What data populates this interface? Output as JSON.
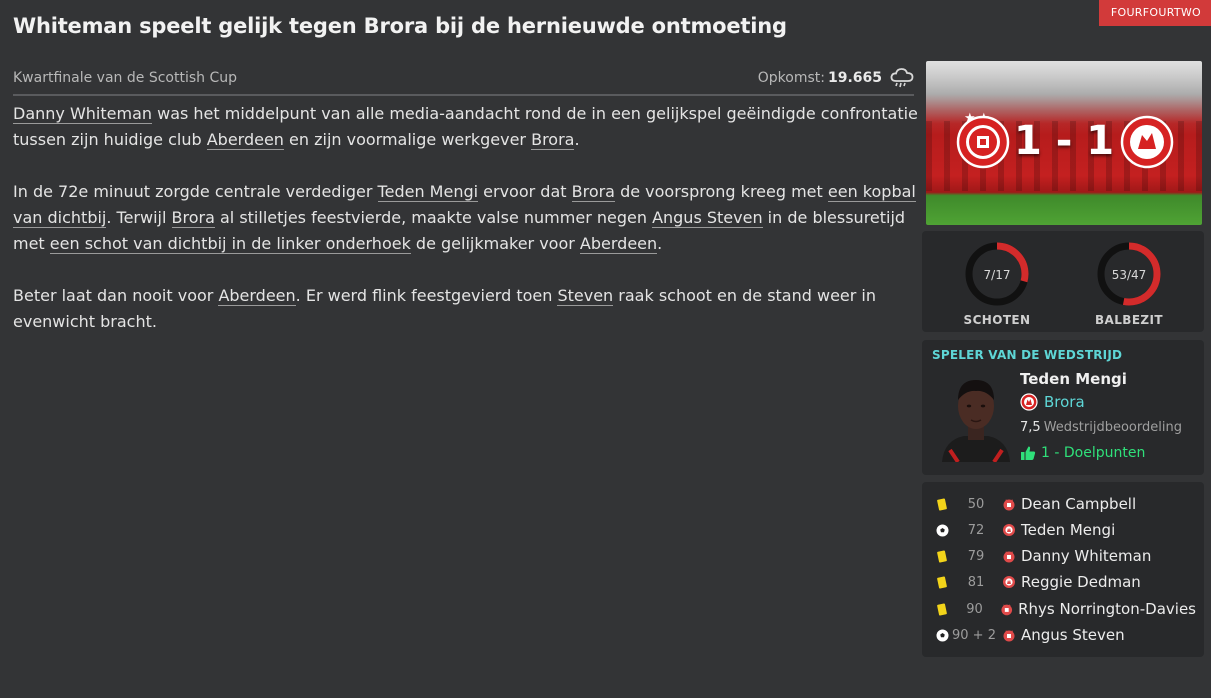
{
  "source": "FOURFOURTWO",
  "headline": "Whiteman speelt gelijk tegen Brora bij de hernieuwde ontmoeting",
  "competition": "Kwartfinale van de Scottish Cup",
  "attendance": {
    "label": "Opkomst:",
    "value": "19.665",
    "weather_icon": "rain-cloud-icon"
  },
  "article": {
    "p1": {
      "s1": "Danny Whiteman",
      "s2": " was het middelpunt van alle media-aandacht rond de in een gelijkspel geëindigde confrontatie tussen zijn huidige club ",
      "s3": "Aberdeen",
      "s4": " en zijn voormalige werkgever ",
      "s5": "Brora",
      "s6": "."
    },
    "p2": {
      "s1": "In de 72e minuut zorgde centrale verdediger ",
      "s2": "Teden Mengi",
      "s3": " ervoor dat ",
      "s4": "Brora",
      "s5": " de voorsprong kreeg met ",
      "s6": "een kopbal van dichtbij",
      "s7": ". Terwijl ",
      "s8": "Brora",
      "s9": " al stilletjes feestvierde, maakte valse nummer negen ",
      "s10": "Angus Steven",
      "s11": " in de blessuretijd met ",
      "s12": "een schot van dichtbij in de linker onderhoek",
      "s13": " de gelijkmaker voor ",
      "s14": "Aberdeen",
      "s15": "."
    },
    "p3": {
      "s1": "Beter laat dan nooit voor ",
      "s2": "Aberdeen",
      "s3": ". Er werd flink feestgevierd toen ",
      "s4": "Steven",
      "s5": " raak schoot en de stand weer in evenwicht bracht."
    }
  },
  "score": {
    "text": "1 - 1",
    "home": 1,
    "away": 1
  },
  "stats": {
    "shots": {
      "label": "SCHOTEN",
      "text": "7/17",
      "home": 7,
      "away": 17
    },
    "possession": {
      "label": "BALBEZIT",
      "text": "53/47",
      "home": 53,
      "away": 47
    }
  },
  "colors": {
    "accent_red": "#d32b2b",
    "teal": "#5ed6d6",
    "green": "#2fe07a",
    "yellow_card": "#f3d41a"
  },
  "motm": {
    "title": "SPELER VAN DE WEDSTRIJD",
    "name": "Teden Mengi",
    "club": "Brora",
    "rating_value": "7,5",
    "rating_label": "Wedstrijdbeoordeling",
    "goals": "1 - Doelpunten"
  },
  "events": [
    {
      "type": "yellow-card",
      "minute": "50",
      "team": "aberdeen",
      "player": "Dean Campbell"
    },
    {
      "type": "goal",
      "minute": "72",
      "team": "brora",
      "player": "Teden Mengi"
    },
    {
      "type": "yellow-card",
      "minute": "79",
      "team": "aberdeen",
      "player": "Danny Whiteman"
    },
    {
      "type": "yellow-card",
      "minute": "81",
      "team": "brora",
      "player": "Reggie Dedman"
    },
    {
      "type": "yellow-card",
      "minute": "90",
      "team": "aberdeen",
      "player": "Rhys Norrington-Davies"
    },
    {
      "type": "goal",
      "minute": "90 + 2",
      "team": "aberdeen",
      "player": "Angus Steven"
    }
  ]
}
